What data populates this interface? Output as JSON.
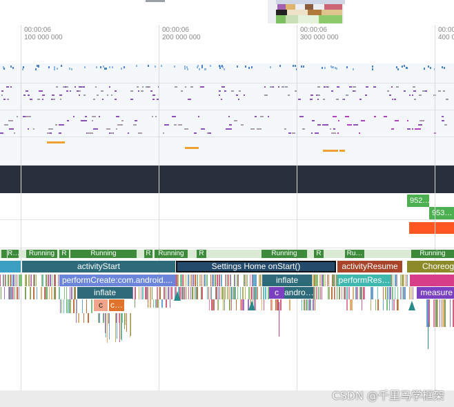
{
  "ruler": {
    "ticks": [
      {
        "time": "00:00:06",
        "ns": "100 000 000"
      },
      {
        "time": "00:00:06",
        "ns": "200 000 000"
      },
      {
        "time": "00:00:06",
        "ns": "300 000 000"
      },
      {
        "time": "00:00:06",
        "ns": "400 0"
      }
    ]
  },
  "counters": {
    "value_1": "952…",
    "value_2": "953…"
  },
  "thread_state": {
    "labels": [
      "R…",
      "Running",
      "R",
      "Running",
      "R",
      "Running",
      "R",
      "Running",
      "R",
      "Ru…",
      "Running"
    ]
  },
  "slices": {
    "activity_start": "activityStart",
    "settings_home_onstart": "Settings Home onStart()",
    "activity_resume": "activityResume",
    "choreographer": "Choreogra",
    "perform_create": "performCreate:com.android....",
    "inflate_1": "inflate",
    "perform_resume": "performRes…",
    "inflate_2": "inflate",
    "c_1": "c",
    "c_2": "c…",
    "c_3": "c",
    "andro": "andro…",
    "measure": "measure"
  },
  "colors": {
    "running": "#3d8b3a",
    "counter": "#4caf50",
    "alert": "#ff5722",
    "selection_border": "#111111"
  },
  "watermark": "CSDN @千里马学框架"
}
